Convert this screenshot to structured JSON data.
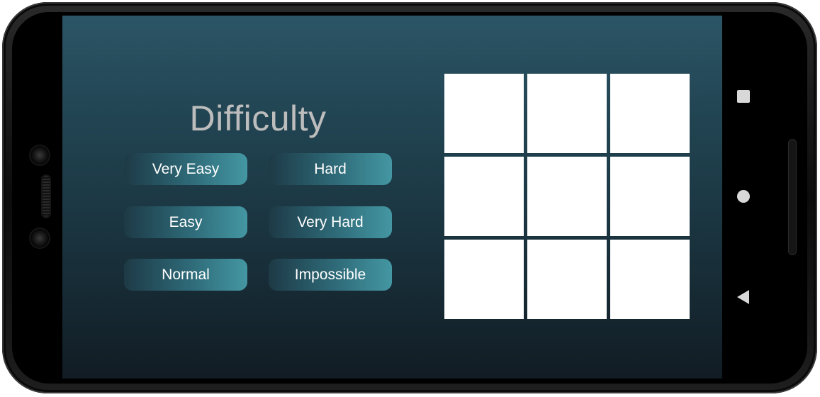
{
  "title": "Difficulty",
  "difficulty_buttons": [
    {
      "label": "Very Easy"
    },
    {
      "label": "Hard"
    },
    {
      "label": "Easy"
    },
    {
      "label": "Very Hard"
    },
    {
      "label": "Normal"
    },
    {
      "label": "Impossible"
    }
  ],
  "board": {
    "cells": [
      "",
      "",
      "",
      "",
      "",
      "",
      "",
      "",
      ""
    ]
  },
  "nav_bar": {
    "icons": [
      "recents-square-icon",
      "home-circle-icon",
      "back-triangle-icon"
    ]
  },
  "colors": {
    "screen_top": "#2b5566",
    "screen_bottom": "#111c24",
    "button_start": "#1d3a46",
    "button_end": "#4497a3",
    "title_text": "#bdbdbd",
    "cell_fill": "#ffffff"
  }
}
